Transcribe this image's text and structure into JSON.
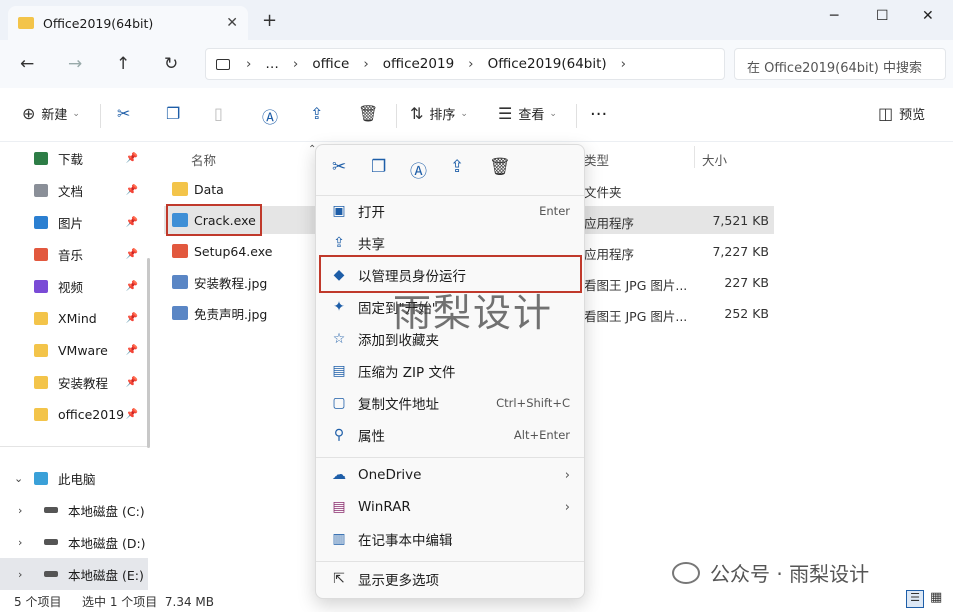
{
  "window": {
    "tab_title": "Office2019(64bit)",
    "tab_close": "✕",
    "new_tab": "+",
    "minimize": "─",
    "maximize": "☐",
    "close": "✕"
  },
  "nav": {
    "back": "←",
    "forward": "→",
    "up": "↑",
    "refresh": "↻",
    "breadcrumb": [
      "…",
      "office",
      "office2019",
      "Office2019(64bit)"
    ],
    "search_placeholder": "在 Office2019(64bit) 中搜索"
  },
  "toolbar": {
    "new_label": "新建",
    "sort_label": "排序",
    "view_label": "查看",
    "more": "···",
    "preview_label": "预览"
  },
  "sidebar": {
    "items": [
      {
        "label": "下载",
        "icon": "download-icon",
        "color": "#2d7d46"
      },
      {
        "label": "文档",
        "icon": "document-icon",
        "color": "#8a8f98"
      },
      {
        "label": "图片",
        "icon": "picture-icon",
        "color": "#2b7fd1"
      },
      {
        "label": "音乐",
        "icon": "music-icon",
        "color": "#e2583e"
      },
      {
        "label": "视频",
        "icon": "video-icon",
        "color": "#7a4bd6"
      },
      {
        "label": "XMind",
        "icon": "folder-icon",
        "color": "#f3c44a"
      },
      {
        "label": "VMware",
        "icon": "folder-icon",
        "color": "#f3c44a"
      },
      {
        "label": "安装教程",
        "icon": "folder-icon",
        "color": "#f3c44a"
      },
      {
        "label": "office2019",
        "icon": "folder-icon",
        "color": "#f3c44a"
      }
    ],
    "this_pc": "此电脑",
    "drives": [
      "本地磁盘 (C:)",
      "本地磁盘 (D:)",
      "本地磁盘 (E:)"
    ]
  },
  "columns": {
    "name": "名称",
    "type": "类型",
    "size": "大小"
  },
  "files": [
    {
      "name": "Data",
      "type": "文件夹",
      "size": "",
      "icon": "folder-icon"
    },
    {
      "name": "Crack.exe",
      "type": "应用程序",
      "size": "7,521 KB",
      "icon": "crack-exe-icon"
    },
    {
      "name": "Setup64.exe",
      "type": "应用程序",
      "size": "7,227 KB",
      "icon": "office-setup-icon"
    },
    {
      "name": "安装教程.jpg",
      "type": "看图王 JPG 图片...",
      "size": "227 KB",
      "icon": "jpg-icon"
    },
    {
      "name": "免责声明.jpg",
      "type": "看图王 JPG 图片...",
      "size": "252 KB",
      "icon": "jpg-icon"
    }
  ],
  "context_menu": {
    "items": [
      {
        "label": "打开",
        "shortcut": "Enter",
        "icon": "open-icon"
      },
      {
        "label": "共享",
        "shortcut": "",
        "icon": "share-icon"
      },
      {
        "label": "以管理员身份运行",
        "shortcut": "",
        "icon": "shield-icon"
      },
      {
        "label": "固定到\"开始\"",
        "shortcut": "",
        "icon": "pin-icon"
      },
      {
        "label": "添加到收藏夹",
        "shortcut": "",
        "icon": "star-icon"
      },
      {
        "label": "压缩为 ZIP 文件",
        "shortcut": "",
        "icon": "zip-icon"
      },
      {
        "label": "复制文件地址",
        "shortcut": "Ctrl+Shift+C",
        "icon": "copy-path-icon"
      },
      {
        "label": "属性",
        "shortcut": "Alt+Enter",
        "icon": "properties-icon"
      }
    ],
    "submenus": [
      {
        "label": "OneDrive",
        "icon": "onedrive-icon"
      },
      {
        "label": "WinRAR",
        "icon": "winrar-icon"
      }
    ],
    "notepad": "在记事本中编辑",
    "more_options": "显示更多选项"
  },
  "status": {
    "count": "5 个项目",
    "selected": "选中 1 个项目  7.34 MB"
  },
  "watermark": "雨梨设计",
  "footer_mark": "公众号 · 雨梨设计",
  "colors": {
    "accent": "#1e5ea8",
    "highlight_box": "#c0392b",
    "folder": "#f3c44a"
  }
}
